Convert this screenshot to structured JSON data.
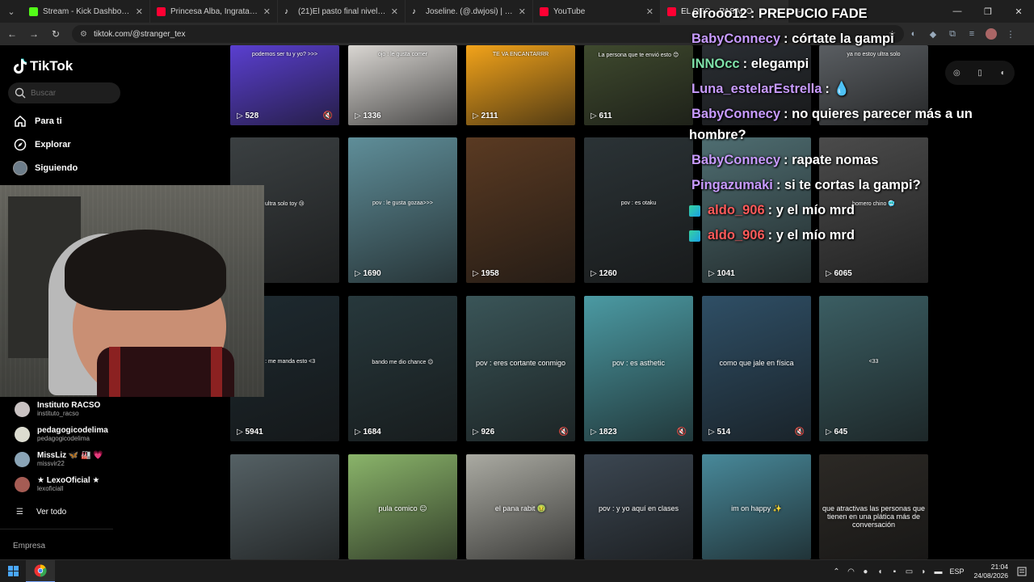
{
  "browser": {
    "tabs": [
      {
        "label": "Stream - Kick Dashboard",
        "icon": "kick-icon",
        "color": "#53fc18",
        "active": false
      },
      {
        "label": "Princesa Alba, Ingratax, Katteyes",
        "icon": "youtube-icon",
        "color": "#ff0033",
        "active": false
      },
      {
        "label": "(21)El pasto final nivel Geometry",
        "icon": "tiktok-icon",
        "color": "#ffffff",
        "active": false
      },
      {
        "label": "Joseline. (@.dwjosi) | TikTok",
        "icon": "tiktok-icon",
        "color": "#ffffff",
        "active": false
      },
      {
        "label": "YouTube",
        "icon": "youtube-icon",
        "color": "#ff0033",
        "active": false
      },
      {
        "label": "EL OSC... PASADO",
        "icon": "youtube-icon",
        "color": "#ff0033",
        "active": true
      }
    ],
    "url": "tiktok.com/@stranger_tex",
    "active_tab_tail": "tranger_te"
  },
  "sidebar": {
    "logo": "TikTok",
    "search_placeholder": "Buscar",
    "nav": [
      {
        "label": "Para ti",
        "icon": "home-icon"
      },
      {
        "label": "Explorar",
        "icon": "compass-icon"
      },
      {
        "label": "Siguiendo",
        "icon": "following-avatar"
      }
    ],
    "following": [
      {
        "name": "Instituto RACSO",
        "handle": "instituto_racso",
        "color": "#c9c2c2"
      },
      {
        "name": "pedagogicodelima",
        "handle": "pedagogicodelima",
        "color": "#dcdcd0"
      },
      {
        "name": "MissLiz 🦋 🏭 💗",
        "handle": "missvir22",
        "color": "#8aa4b6"
      },
      {
        "name": "★ LexoOficial ★",
        "handle": "lexoficiall",
        "color": "#a55c54"
      }
    ],
    "see_all": "Ver todo",
    "company": "Empresa"
  },
  "chat": [
    {
      "user": "elrooo12",
      "user_color": "#ffffff",
      "msg": ": PREPUCIO FADE",
      "badge": false
    },
    {
      "user": "BabyConnecy",
      "user_color": "#c89bff",
      "msg": ": córtate la gampi",
      "badge": false
    },
    {
      "user": "INNOcc",
      "user_color": "#7ee0a8",
      "msg": ": elegampi",
      "badge": false
    },
    {
      "user": "Luna_estelarEstrella",
      "user_color": "#c89bff",
      "msg": ": 💧",
      "badge": false
    },
    {
      "user": "BabyConnecy",
      "user_color": "#c89bff",
      "msg": ": no quieres parecer más a un",
      "badge": false
    },
    {
      "user": "",
      "user_color": "#ffffff",
      "msg": "hombre?",
      "badge": false
    },
    {
      "user": "BabyConnecy",
      "user_color": "#c89bff",
      "msg": ": rapate nomas",
      "badge": false
    },
    {
      "user": "Pingazumaki",
      "user_color": "#c89bff",
      "msg": ": si te cortas la gampi?",
      "badge": false
    },
    {
      "user": "aldo_906",
      "user_color": "#ff5a5a",
      "msg": ": y el mío mrd",
      "badge": true
    },
    {
      "user": "aldo_906",
      "user_color": "#ff5a5a",
      "msg": ": y el mío mrd",
      "badge": true
    }
  ],
  "videos": [
    {
      "views": "528",
      "caption": "podemos ser tu y yo? >>>",
      "muted": true,
      "bg": "#5a3fd0"
    },
    {
      "views": "1336",
      "caption": "ojo : le gusta comer",
      "muted": false,
      "bg": "#d9d6d2"
    },
    {
      "views": "2111",
      "caption": "TE VA ENCANTARRR",
      "muted": false,
      "bg": "#f2a31a"
    },
    {
      "views": "611",
      "caption": "La persona que te envió esto 😊",
      "muted": false,
      "bg": "#3f4a2e"
    },
    {
      "views": "",
      "caption": "",
      "muted": false,
      "bg": "#2a2e33"
    },
    {
      "views": "",
      "caption": "ya no estoy ultra solo",
      "muted": false,
      "bg": "#5a5e62"
    },
    {
      "views": "",
      "caption": "ultra solo toy 😢",
      "muted": false,
      "bg": "#3b4042"
    },
    {
      "views": "1690",
      "caption": "pov : le gusta gozaa>>>",
      "muted": false,
      "bg": "#5f8e99"
    },
    {
      "views": "1958",
      "caption": "",
      "muted": false,
      "bg": "#5a3a22"
    },
    {
      "views": "1260",
      "caption": "pov : es otaku",
      "muted": false,
      "bg": "#2b3336"
    },
    {
      "views": "1041",
      "caption": "",
      "muted": false,
      "bg": "#4f6e72"
    },
    {
      "views": "6065",
      "caption": "homero chino 🥶",
      "muted": false,
      "bg": "#4b4b4b"
    },
    {
      "views": "5941",
      "caption": "pov : me manda esto <3",
      "muted": false,
      "bg": "#1e2a30"
    },
    {
      "views": "1684",
      "caption": "bando me dio chance 😉",
      "muted": false,
      "bg": "#27383c"
    },
    {
      "views": "926",
      "caption": "pov : eres cortante conmigo",
      "muted": true,
      "bg": "#3a5558"
    },
    {
      "views": "1823",
      "caption": "pov : es asthetic",
      "muted": true,
      "bg": "#4b9aa3"
    },
    {
      "views": "514",
      "caption": "como que jale en física",
      "muted": true,
      "bg": "#2f4f66"
    },
    {
      "views": "645",
      "caption": "<33",
      "muted": false,
      "bg": "#3b5e63"
    },
    {
      "views": "",
      "caption": "",
      "muted": false,
      "bg": "#556165"
    },
    {
      "views": "",
      "caption": "pula comico 😐",
      "muted": false,
      "bg": "#8ab46a"
    },
    {
      "views": "",
      "caption": "el pana rabit 🤢",
      "muted": false,
      "bg": "#aaaaa2"
    },
    {
      "views": "",
      "caption": "pov : y yo aquí en clases",
      "muted": false,
      "bg": "#3c4752"
    },
    {
      "views": "",
      "caption": "im on happy ✨",
      "muted": false,
      "bg": "#48899a"
    },
    {
      "views": "",
      "caption": "que atractivas las personas que tienen en una plática más de conversación",
      "muted": false,
      "bg": "#2c2925"
    }
  ],
  "taskbar": {
    "lang": "ESP",
    "time": "21:04",
    "date": "24/08/2026"
  }
}
